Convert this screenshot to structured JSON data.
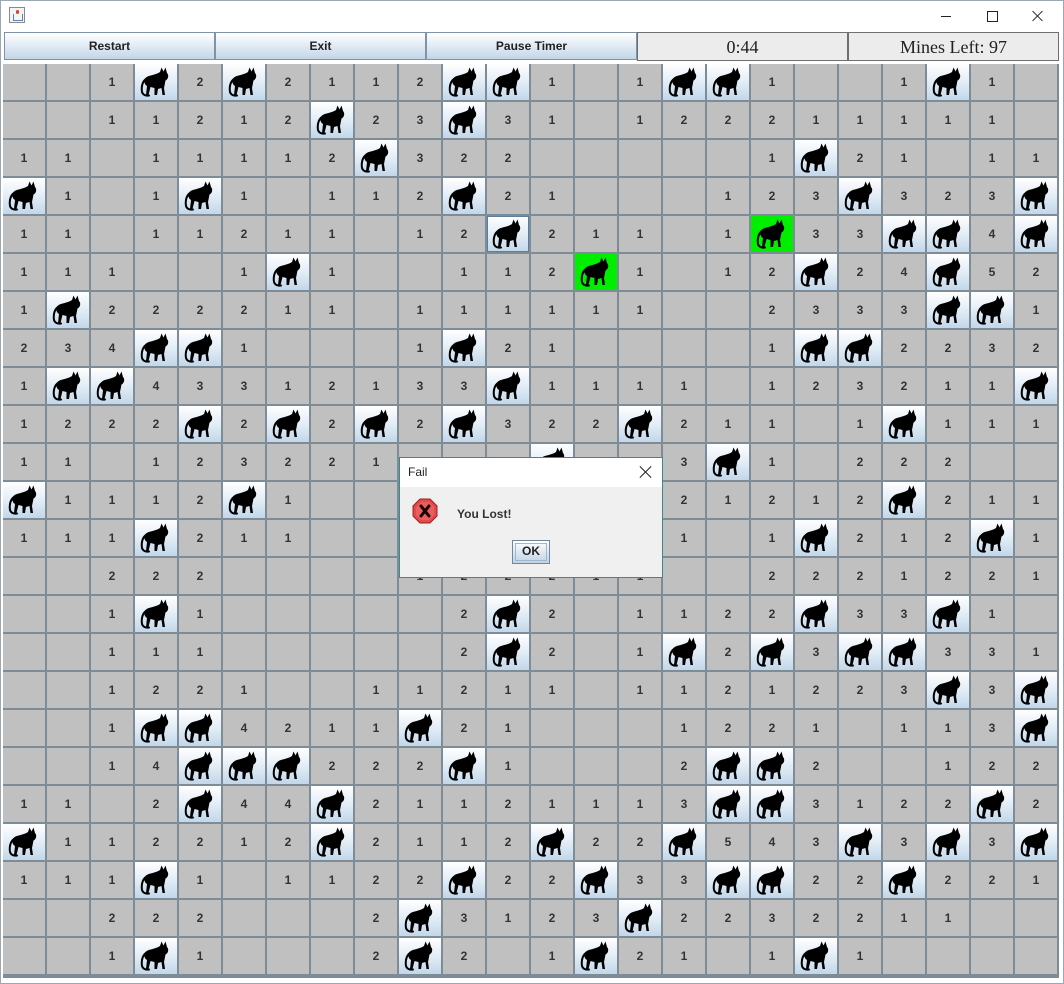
{
  "window": {
    "minimize_icon": "minimize-icon",
    "maximize_icon": "maximize-icon",
    "close_icon": "close-icon"
  },
  "toolbar": {
    "restart_label": "Restart",
    "exit_label": "Exit",
    "pause_label": "Pause Timer",
    "timer": "0:44",
    "mines_left": "Mines Left: 97"
  },
  "board": {
    "cols": 24,
    "rows": 24,
    "legend": "M = mine (cat icon), H = detonated mine (green), digits = adjacent mine count, . = empty revealed, ? = hidden behind dialog",
    "selected_cell": {
      "row": 4,
      "col": 11
    },
    "colors": {
      "revealed": "#c0c0c0",
      "grid": "#7d8c97",
      "hit": "#00ee00"
    },
    "rows_data": [
      [
        ".",
        ".",
        "1",
        "M",
        "2",
        "M",
        "2",
        "1",
        "1",
        "2",
        "M",
        "M",
        "1",
        ".",
        "1",
        "M",
        "M",
        "1",
        ".",
        ".",
        "1",
        "M",
        "1",
        "."
      ],
      [
        ".",
        ".",
        "1",
        "1",
        "2",
        "1",
        "2",
        "M",
        "2",
        "3",
        "M",
        "3",
        "1",
        ".",
        "1",
        "2",
        "2",
        "2",
        "1",
        "1",
        "1",
        "1",
        "1",
        "."
      ],
      [
        "1",
        "1",
        ".",
        "1",
        "1",
        "1",
        "1",
        "2",
        "M",
        "3",
        "2",
        "2",
        ".",
        ".",
        ".",
        ".",
        ".",
        "1",
        "M",
        "2",
        "1",
        ".",
        "1",
        "1"
      ],
      [
        "M",
        "1",
        ".",
        "1",
        "M",
        "1",
        ".",
        "1",
        "1",
        "2",
        "M",
        "2",
        "1",
        ".",
        ".",
        ".",
        "1",
        "2",
        "3",
        "M",
        "3",
        "2",
        "3",
        "M"
      ],
      [
        "1",
        "1",
        ".",
        "1",
        "1",
        "2",
        "1",
        "1",
        ".",
        "1",
        "2",
        "M",
        "2",
        "1",
        "1",
        ".",
        "1",
        "H",
        "3",
        "3",
        "M",
        "M",
        "4",
        "M"
      ],
      [
        "1",
        "1",
        "1",
        ".",
        ".",
        "1",
        "M",
        "1",
        ".",
        ".",
        "1",
        "1",
        "2",
        "H",
        "1",
        ".",
        "1",
        "2",
        "M",
        "2",
        "4",
        "M",
        "5",
        "2"
      ],
      [
        "1",
        "M",
        "2",
        "2",
        "2",
        "2",
        "1",
        "1",
        ".",
        "1",
        "1",
        "1",
        "1",
        "1",
        "1",
        ".",
        ".",
        "2",
        "3",
        "3",
        "3",
        "M",
        "M",
        "1"
      ],
      [
        "2",
        "3",
        "4",
        "M",
        "M",
        "1",
        ".",
        ".",
        ".",
        "1",
        "M",
        "2",
        "1",
        ".",
        ".",
        ".",
        ".",
        "1",
        "M",
        "M",
        "2",
        "2",
        "3",
        "2"
      ],
      [
        "1",
        "M",
        "M",
        "4",
        "3",
        "3",
        "1",
        "2",
        "1",
        "3",
        "3",
        "M",
        "1",
        "1",
        "1",
        "1",
        ".",
        "1",
        "2",
        "3",
        "2",
        "1",
        "1",
        "M"
      ],
      [
        "1",
        "2",
        "2",
        "2",
        "M",
        "2",
        "M",
        "2",
        "M",
        "2",
        "M",
        "3",
        "2",
        "2",
        "M",
        "2",
        "1",
        "1",
        ".",
        "1",
        "M",
        "1",
        "1",
        "1"
      ],
      [
        "1",
        "1",
        ".",
        "1",
        "2",
        "3",
        "2",
        "2",
        "1",
        "?",
        "?",
        "?",
        "M",
        "?",
        "?",
        "3",
        "M",
        "1",
        ".",
        "2",
        "2",
        "2",
        ".",
        "."
      ],
      [
        "M",
        "1",
        "1",
        "1",
        "2",
        "M",
        "1",
        ".",
        ".",
        "?",
        "?",
        "?",
        "?",
        "?",
        "?",
        "2",
        "1",
        "2",
        "1",
        "2",
        "M",
        "2",
        "1",
        "1"
      ],
      [
        "1",
        "1",
        "1",
        "M",
        "2",
        "1",
        "1",
        ".",
        ".",
        "?",
        "?",
        "?",
        "?",
        "?",
        "?",
        "1",
        ".",
        "1",
        "M",
        "2",
        "1",
        "2",
        "M",
        "1"
      ],
      [
        ".",
        ".",
        "2",
        "2",
        "2",
        ".",
        ".",
        ".",
        ".",
        "1",
        "2",
        "2",
        "2",
        "1",
        "1",
        ".",
        ".",
        "2",
        "2",
        "2",
        "1",
        "2",
        "2",
        "1"
      ],
      [
        ".",
        ".",
        "1",
        "M",
        "1",
        ".",
        ".",
        ".",
        ".",
        ".",
        "2",
        "M",
        "2",
        ".",
        "1",
        "1",
        "2",
        "2",
        "M",
        "3",
        "3",
        "M",
        "1",
        "."
      ],
      [
        ".",
        ".",
        "1",
        "1",
        "1",
        ".",
        ".",
        ".",
        ".",
        ".",
        "2",
        "M",
        "2",
        ".",
        "1",
        "M",
        "2",
        "M",
        "3",
        "M",
        "M",
        "3",
        "3",
        "1"
      ],
      [
        ".",
        ".",
        "1",
        "2",
        "2",
        "1",
        ".",
        ".",
        "1",
        "1",
        "2",
        "1",
        "1",
        ".",
        "1",
        "1",
        "2",
        "1",
        "2",
        "2",
        "3",
        "M",
        "3",
        "M"
      ],
      [
        ".",
        ".",
        "1",
        "M",
        "M",
        "4",
        "2",
        "1",
        "1",
        "M",
        "2",
        "1",
        ".",
        ".",
        ".",
        "1",
        "2",
        "2",
        "1",
        ".",
        "1",
        "1",
        "3",
        "M"
      ],
      [
        ".",
        ".",
        "1",
        "4",
        "M",
        "M",
        "M",
        "2",
        "2",
        "2",
        "M",
        "1",
        ".",
        ".",
        ".",
        "2",
        "M",
        "M",
        "2",
        ".",
        ".",
        "1",
        "2",
        "2"
      ],
      [
        "1",
        "1",
        ".",
        "2",
        "M",
        "4",
        "4",
        "M",
        "2",
        "1",
        "1",
        "2",
        "1",
        "1",
        "1",
        "3",
        "M",
        "M",
        "3",
        "1",
        "2",
        "2",
        "M",
        "2"
      ],
      [
        "M",
        "1",
        "1",
        "2",
        "2",
        "1",
        "2",
        "M",
        "2",
        "1",
        "1",
        "2",
        "M",
        "2",
        "2",
        "M",
        "5",
        "4",
        "3",
        "M",
        "3",
        "M",
        "3",
        "M"
      ],
      [
        "1",
        "1",
        "1",
        "M",
        "1",
        ".",
        "1",
        "1",
        "2",
        "2",
        "M",
        "2",
        "2",
        "M",
        "3",
        "3",
        "M",
        "M",
        "2",
        "2",
        "M",
        "2",
        "2",
        "1"
      ],
      [
        ".",
        ".",
        "2",
        "2",
        "2",
        ".",
        ".",
        ".",
        "2",
        "M",
        "3",
        "1",
        "2",
        "3",
        "M",
        "2",
        "2",
        "3",
        "2",
        "2",
        "1",
        "1",
        ".",
        "."
      ],
      [
        ".",
        ".",
        "1",
        "M",
        "1",
        ".",
        ".",
        ".",
        "2",
        "M",
        "2",
        ".",
        "1",
        "M",
        "2",
        "1",
        ".",
        "1",
        "M",
        "1",
        ".",
        ".",
        ".",
        "."
      ]
    ]
  },
  "dialog": {
    "title": "Fail",
    "message": "You Lost!",
    "ok_label": "OK",
    "icon": "error-icon"
  }
}
